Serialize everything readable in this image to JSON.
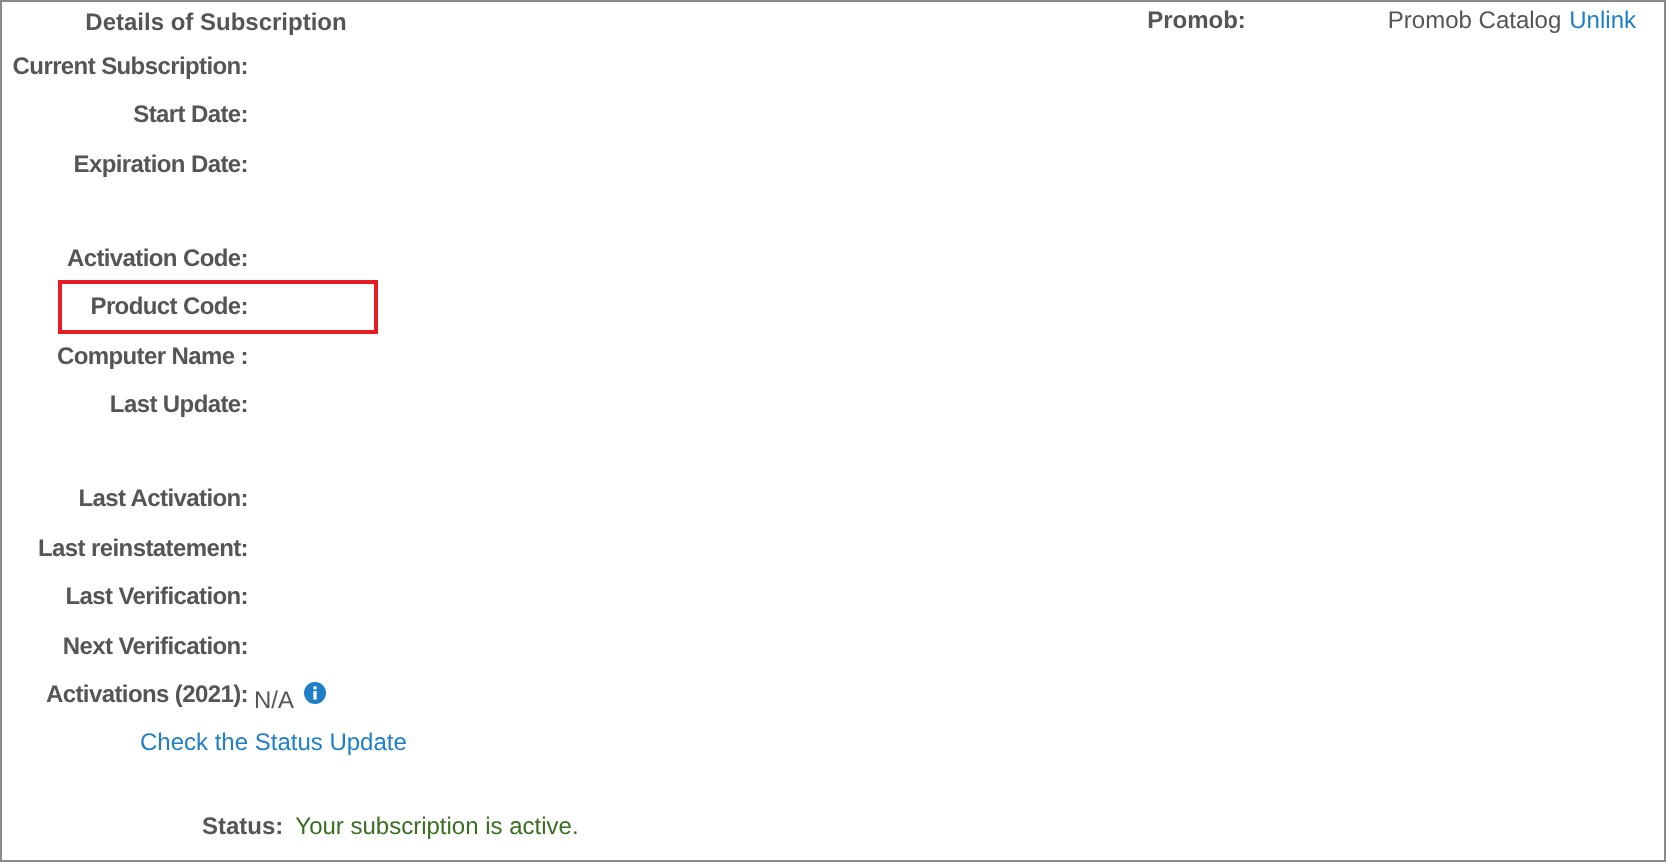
{
  "heading": "Details of Subscription",
  "groups": [
    [
      {
        "label": "Current Subscription:",
        "highlighted": false
      },
      {
        "label": "Start Date:",
        "highlighted": false
      },
      {
        "label": "Expiration Date:",
        "highlighted": false
      }
    ],
    [
      {
        "label": "Activation Code:",
        "highlighted": false
      },
      {
        "label": "Product Code:",
        "highlighted": true
      },
      {
        "label": "Computer Name :",
        "highlighted": false
      },
      {
        "label": "Last Update:",
        "highlighted": false
      }
    ],
    [
      {
        "label": "Last Activation:",
        "highlighted": false
      },
      {
        "label": "Last reinstatement:",
        "highlighted": false
      },
      {
        "label": "Last Verification:",
        "highlighted": false
      },
      {
        "label": "Next Verification:",
        "highlighted": false
      },
      {
        "label": "Activations (2021):",
        "highlighted": false,
        "value": "N/A",
        "info": true
      }
    ]
  ],
  "check_link": "Check the Status Update",
  "status": {
    "label": "Status:",
    "value": "Your subscription is active."
  },
  "promob": {
    "label": "Promob:",
    "catalog": "Promob Catalog",
    "link": "Unlink"
  }
}
